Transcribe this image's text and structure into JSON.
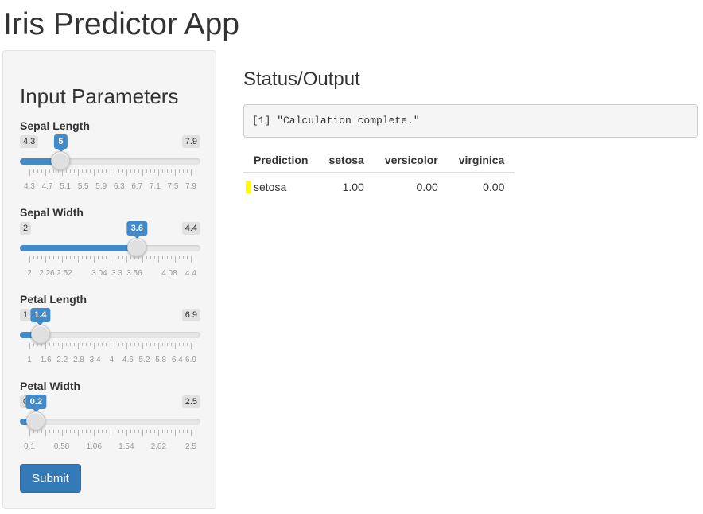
{
  "app": {
    "title": "Iris Predictor App"
  },
  "sidebar": {
    "title": "Input Parameters",
    "sliders": [
      {
        "label": "Sepal Length",
        "min": 4.3,
        "max": 7.9,
        "value": 5,
        "min_label": "4.3",
        "max_label": "7.9",
        "value_label": "5",
        "ticks": [
          "4.3",
          "4.7",
          "5.1",
          "5.5",
          "5.9",
          "6.3",
          "6.7",
          "7.1",
          "7.5",
          "7.9"
        ]
      },
      {
        "label": "Sepal Width",
        "min": 2,
        "max": 4.4,
        "value": 3.6,
        "min_label": "2",
        "max_label": "4.4",
        "value_label": "3.6",
        "ticks": [
          "2",
          "2.26",
          "2.52",
          "3.04",
          "3.3",
          "3.56",
          "4.08",
          "4.4"
        ]
      },
      {
        "label": "Petal Length",
        "min": 1,
        "max": 6.9,
        "value": 1.4,
        "min_label": "1",
        "max_label": "6.9",
        "value_label": "1.4",
        "ticks": [
          "1",
          "1.6",
          "2.2",
          "2.8",
          "3.4",
          "4",
          "4.6",
          "5.2",
          "5.8",
          "6.4",
          "6.9"
        ]
      },
      {
        "label": "Petal Width",
        "min": 0.1,
        "max": 2.5,
        "value": 0.2,
        "min_label": "0.1",
        "max_label": "2.5",
        "value_label": "0.2",
        "ticks": [
          "0.1",
          "0.58",
          "1.06",
          "1.54",
          "2.02",
          "2.5"
        ]
      }
    ],
    "submit_label": "Submit"
  },
  "main": {
    "title": "Status/Output",
    "status_text": "[1] \"Calculation complete.\"",
    "table": {
      "headers": [
        "Prediction",
        "setosa",
        "versicolor",
        "virginica"
      ],
      "rows": [
        [
          "setosa",
          "1.00",
          "0.00",
          "0.00"
        ]
      ],
      "highlight_color": "#ffff00"
    }
  },
  "colors": {
    "accent": "#428bca",
    "button": "#337ab7"
  }
}
